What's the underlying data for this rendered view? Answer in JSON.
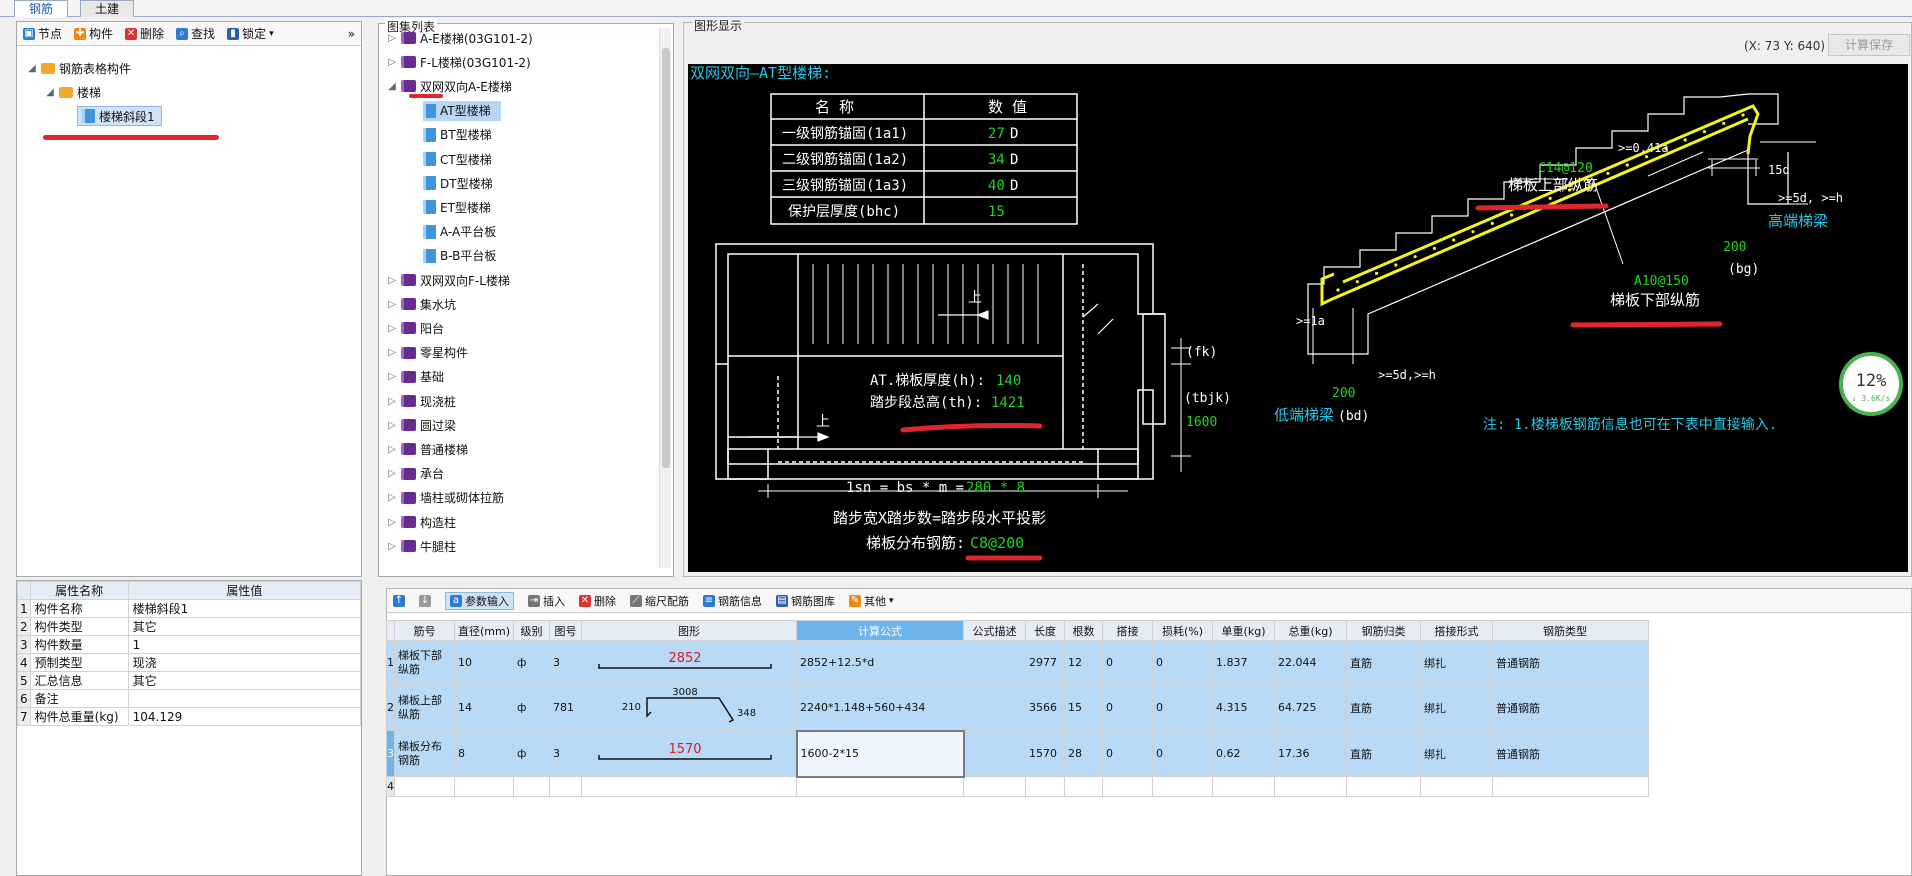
{
  "tabs": [
    "钢筋",
    "土建"
  ],
  "left_toolbar": [
    "节点",
    "构件",
    "删除",
    "查找",
    "锁定"
  ],
  "left_tree": {
    "root": "钢筋表格构件",
    "child": "楼梯",
    "leaf": "楼梯斜段1"
  },
  "props": {
    "headers": [
      "属性名称",
      "属性值"
    ],
    "rows": [
      {
        "n": "1",
        "name": "构件名称",
        "value": "楼梯斜段1"
      },
      {
        "n": "2",
        "name": "构件类型",
        "value": "其它"
      },
      {
        "n": "3",
        "name": "构件数量",
        "value": "1"
      },
      {
        "n": "4",
        "name": "预制类型",
        "value": "现浇"
      },
      {
        "n": "5",
        "name": "汇总信息",
        "value": "其它"
      },
      {
        "n": "6",
        "name": "备注",
        "value": ""
      },
      {
        "n": "7",
        "name": "构件总重量(kg)",
        "value": "104.129"
      }
    ]
  },
  "atlas": {
    "title": "图集列表",
    "items": [
      {
        "label": "A-E楼梯(03G101-2)",
        "level": 0,
        "expanded": false
      },
      {
        "label": "F-L楼梯(03G101-2)",
        "level": 0,
        "expanded": false
      },
      {
        "label": "双网双向A-E楼梯",
        "level": 0,
        "expanded": true
      },
      {
        "label": "AT型楼梯",
        "level": 1,
        "selected": true
      },
      {
        "label": "BT型楼梯",
        "level": 1
      },
      {
        "label": "CT型楼梯",
        "level": 1
      },
      {
        "label": "DT型楼梯",
        "level": 1
      },
      {
        "label": "ET型楼梯",
        "level": 1
      },
      {
        "label": "A-A平台板",
        "level": 1
      },
      {
        "label": "B-B平台板",
        "level": 1
      },
      {
        "label": "双网双向F-L楼梯",
        "level": 0
      },
      {
        "label": "集水坑",
        "level": 0
      },
      {
        "label": "阳台",
        "level": 0
      },
      {
        "label": "零星构件",
        "level": 0
      },
      {
        "label": "基础",
        "level": 0
      },
      {
        "label": "现浇桩",
        "level": 0
      },
      {
        "label": "圆过梁",
        "level": 0
      },
      {
        "label": "普通楼梯",
        "level": 0
      },
      {
        "label": "承台",
        "level": 0
      },
      {
        "label": "墙柱或砌体拉筋",
        "level": 0
      },
      {
        "label": "构造柱",
        "level": 0
      },
      {
        "label": "牛腿柱",
        "level": 0
      }
    ]
  },
  "graphic": {
    "title": "图形显示",
    "coords": "(X: 73 Y: 640)",
    "calc_save": "计算保存",
    "heading": "双网双向—AT型楼梯:",
    "param_table": {
      "headers": [
        "名 称",
        "数 值"
      ],
      "rows": [
        {
          "name": "一级钢筋锚固(1a1)",
          "val": "27",
          "unit": "D"
        },
        {
          "name": "二级钢筋锚固(1a2)",
          "val": "34",
          "unit": "D"
        },
        {
          "name": "三级钢筋锚固(1a3)",
          "val": "40",
          "unit": "D"
        },
        {
          "name": "保护层厚度(bhc)",
          "val": "15",
          "unit": ""
        }
      ]
    },
    "up1": "上",
    "up2": "上",
    "thick_label": "AT.梯板厚度(h):",
    "thick_val": "140",
    "height_label": "踏步段总高(th):",
    "height_val": "1421",
    "fk": "(fk)",
    "tbjk": "(tbjk)",
    "v1600": "1600",
    "lsn_a": "1sn = bs * m = ",
    "lsn_b": "280 * 8",
    "step_text": "踏步宽X踏步数=踏步段水平投影",
    "dist_label": "梯板分布钢筋:",
    "dist_val": "C8@200",
    "c14": "C14@120",
    "upper_bar": "梯板上部纵筋",
    "a10": "A10@150",
    "lower_bar": "梯板下部纵筋",
    "ge041": ">=0.41a",
    "d15": "15d",
    "ge5d_top": ">=5d, >=h",
    "high_beam": "高端梯梁",
    "v200_top": "200",
    "bg": "(bg)",
    "ge1a": ">=1a",
    "ge5d_bot": ">=5d,>=h",
    "v200_bot": "200",
    "low_beam": "低端梯梁",
    "bd": "(bd)",
    "note": "注: 1.楼梯板钢筋信息也可在下表中直接输入.",
    "perf": "12%",
    "perf_speed": "↓ 3.6K/s"
  },
  "bottom_toolbar": [
    "参数输入",
    "插入",
    "删除",
    "缩尺配筋",
    "钢筋信息",
    "钢筋图库",
    "其他"
  ],
  "rebar": {
    "headers": [
      "筋号",
      "直径(mm)",
      "级别",
      "图号",
      "图形",
      "计算公式",
      "公式描述",
      "长度",
      "根数",
      "搭接",
      "损耗(%)",
      "单重(kg)",
      "总重(kg)",
      "钢筋归类",
      "搭接形式",
      "钢筋类型"
    ],
    "rows": [
      {
        "n": "1",
        "name": "梯板下部纵筋",
        "dia": "10",
        "grade": "ф",
        "fig": "3",
        "shape_val": "2852",
        "formula": "2852+12.5*d",
        "desc": "",
        "len": "2977",
        "count": "12",
        "lap": "0",
        "loss": "0",
        "unit_w": "1.837",
        "total_w": "22.044",
        "cat": "直筋",
        "lap_type": "绑扎",
        "type": "普通钢筋"
      },
      {
        "n": "2",
        "name": "梯板上部纵筋",
        "dia": "14",
        "grade": "ф",
        "fig": "781",
        "shape_a": "210",
        "shape_b": "3008",
        "shape_c": "348",
        "formula": "2240*1.148+560+434",
        "desc": "",
        "len": "3566",
        "count": "15",
        "lap": "0",
        "loss": "0",
        "unit_w": "4.315",
        "total_w": "64.725",
        "cat": "直筋",
        "lap_type": "绑扎",
        "type": "普通钢筋"
      },
      {
        "n": "3",
        "name": "梯板分布钢筋",
        "dia": "8",
        "grade": "ф",
        "fig": "3",
        "shape_val": "1570",
        "formula": "1600-2*15",
        "desc": "",
        "len": "1570",
        "count": "28",
        "lap": "0",
        "loss": "0",
        "unit_w": "0.62",
        "total_w": "17.36",
        "cat": "直筋",
        "lap_type": "绑扎",
        "type": "普通钢筋"
      },
      {
        "n": "4"
      }
    ]
  },
  "colors": {
    "cad_bg": "#000000",
    "green": "#1bd61b",
    "yellow": "#f5f51a",
    "cyan": "#25c9e8",
    "sel_row": "#b9daf7",
    "highlight": "#e0262d"
  }
}
